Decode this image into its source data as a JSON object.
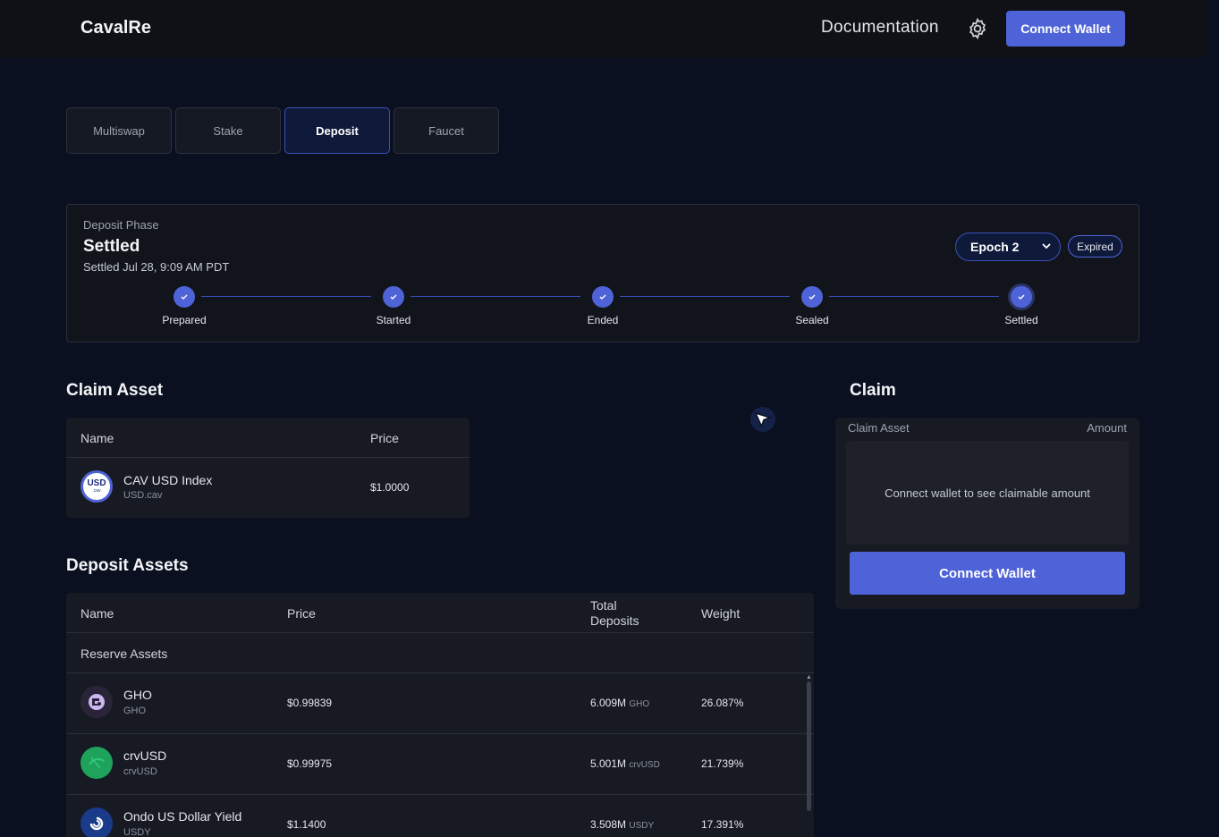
{
  "header": {
    "logo": "CavalRe",
    "documentation": "Documentation",
    "settings_icon": "gear-icon",
    "connect_wallet": "Connect Wallet"
  },
  "tabs": [
    {
      "label": "Multiswap",
      "active": false
    },
    {
      "label": "Stake",
      "active": false
    },
    {
      "label": "Deposit",
      "active": true
    },
    {
      "label": "Faucet",
      "active": false
    }
  ],
  "phase": {
    "label": "Deposit Phase",
    "title": "Settled",
    "subtitle": "Settled Jul 28, 9:09 AM PDT",
    "epoch": "Epoch 2",
    "status_badge": "Expired",
    "steps": [
      "Prepared",
      "Started",
      "Ended",
      "Sealed",
      "Settled"
    ]
  },
  "claim_asset": {
    "title": "Claim Asset",
    "headers": {
      "name": "Name",
      "price": "Price"
    },
    "row": {
      "name": "CAV USD Index",
      "symbol": "USD.cav",
      "price": "$1.0000",
      "icon_text": "USD",
      "icon_subtext": ".cav"
    }
  },
  "deposit_assets": {
    "title": "Deposit Assets",
    "headers": {
      "name": "Name",
      "price": "Price",
      "total_deposits": "Total Deposits",
      "weight": "Weight"
    },
    "group_label": "Reserve Assets",
    "rows": [
      {
        "name": "GHO",
        "symbol": "GHO",
        "price": "$0.99839",
        "deposits": "6.009M",
        "unit": "GHO",
        "weight": "26.087%",
        "icon": "gho-icon"
      },
      {
        "name": "crvUSD",
        "symbol": "crvUSD",
        "price": "$0.99975",
        "deposits": "5.001M",
        "unit": "crvUSD",
        "weight": "21.739%",
        "icon": "crvusd-icon"
      },
      {
        "name": "Ondo US Dollar Yield",
        "symbol": "USDY",
        "price": "$1.1400",
        "deposits": "3.508M",
        "unit": "USDY",
        "weight": "17.391%",
        "icon": "usdy-icon"
      }
    ]
  },
  "claim_panel": {
    "title": "Claim",
    "head_left": "Claim Asset",
    "head_right": "Amount",
    "message": "Connect wallet to see claimable amount",
    "button": "Connect Wallet"
  },
  "colors": {
    "accent": "#4f63d8",
    "background": "#0b1020",
    "panel": "#171a22"
  }
}
